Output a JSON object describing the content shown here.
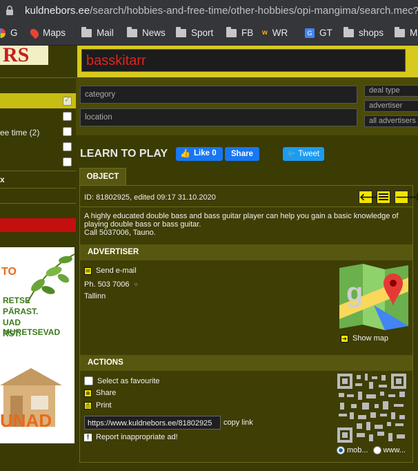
{
  "browser": {
    "url_domain": "kuldnebors.ee",
    "url_path": "/search/hobbies-and-free-time/other-hobbies/opi-mangima/search.mec?pob",
    "bookmarks": [
      "G",
      "Maps",
      "Mail",
      "News",
      "Sport",
      "FB",
      "WR",
      "GT",
      "shops",
      "M"
    ]
  },
  "sidebar": {
    "logo_text": "RS",
    "category_row": "ee time (2)",
    "x_label": "x"
  },
  "search": {
    "query": "basskitarr",
    "category_placeholder": "category",
    "location_placeholder": "location",
    "deal_type": "deal type",
    "advertiser": "advertiser",
    "all_advertisers": "all advertisers"
  },
  "listing": {
    "title": "LEARN TO PLAY",
    "fb_like": "Like 0",
    "fb_share": "Share",
    "tweet": "Tweet",
    "tab_object": "OBJECT",
    "id_line": "ID: 81802925, edited 09:17 31.10.2020",
    "description_1": "A highly educated double bass and bass guitar player can help you gain a basic knowledge of",
    "description_2": "playing double bass or bass guitar.",
    "description_3": "Call 5037006, Tauno."
  },
  "advertiser": {
    "header": "ADVERTISER",
    "send_email": "Send e-mail",
    "phone": "Ph. 503 7006",
    "city": "Tallinn",
    "show_map": "Show map"
  },
  "actions": {
    "header": "ACTIONS",
    "favourite": "Select as favourite",
    "share": "Share",
    "print": "Print",
    "link_value": "https://www.kuldnebors.ee/81802925",
    "copy_link": "copy link",
    "report": "Report inappropriate ad!",
    "radio_mob": "mob...",
    "radio_www": "www..."
  },
  "ad_banner": {
    "line1": "TO",
    "line2": "RETSE",
    "line3": "PÄRAST.",
    "line4": "UAD MURETSEVAD",
    "line5": "RST.",
    "line6": "UNAD"
  },
  "colors": {
    "accent_yellow": "#d7c91d",
    "panel_olive": "#3e3e05",
    "query_red": "#e02424"
  }
}
